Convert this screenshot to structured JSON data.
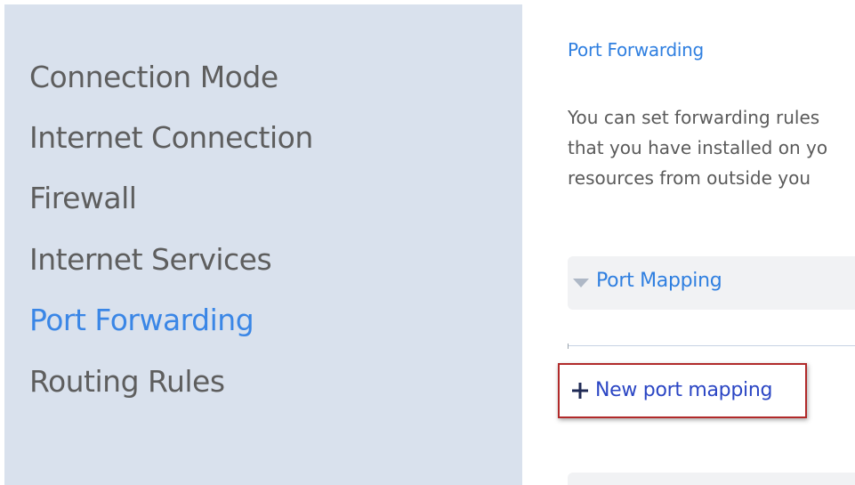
{
  "sidebar": {
    "items": [
      {
        "label": "Connection Mode",
        "active": false
      },
      {
        "label": "Internet Connection",
        "active": false
      },
      {
        "label": "Firewall",
        "active": false
      },
      {
        "label": "Internet Services",
        "active": false
      },
      {
        "label": "Port Forwarding",
        "active": true
      },
      {
        "label": "Routing Rules",
        "active": false
      }
    ]
  },
  "main": {
    "title": "Port Forwarding",
    "description_lines": [
      "You can set forwarding rules",
      "that you have installed on yo",
      "resources from outside you"
    ],
    "accordion": {
      "label": "Port Mapping",
      "icon": "chevron-down-icon"
    },
    "new_mapping": {
      "label": "New port mapping",
      "icon": "plus-icon"
    }
  },
  "colors": {
    "sidebar_bg": "#d9e1ed",
    "active_link": "#3a86e6",
    "highlight_border": "#b12a2a",
    "link_blue": "#2b46c4"
  }
}
